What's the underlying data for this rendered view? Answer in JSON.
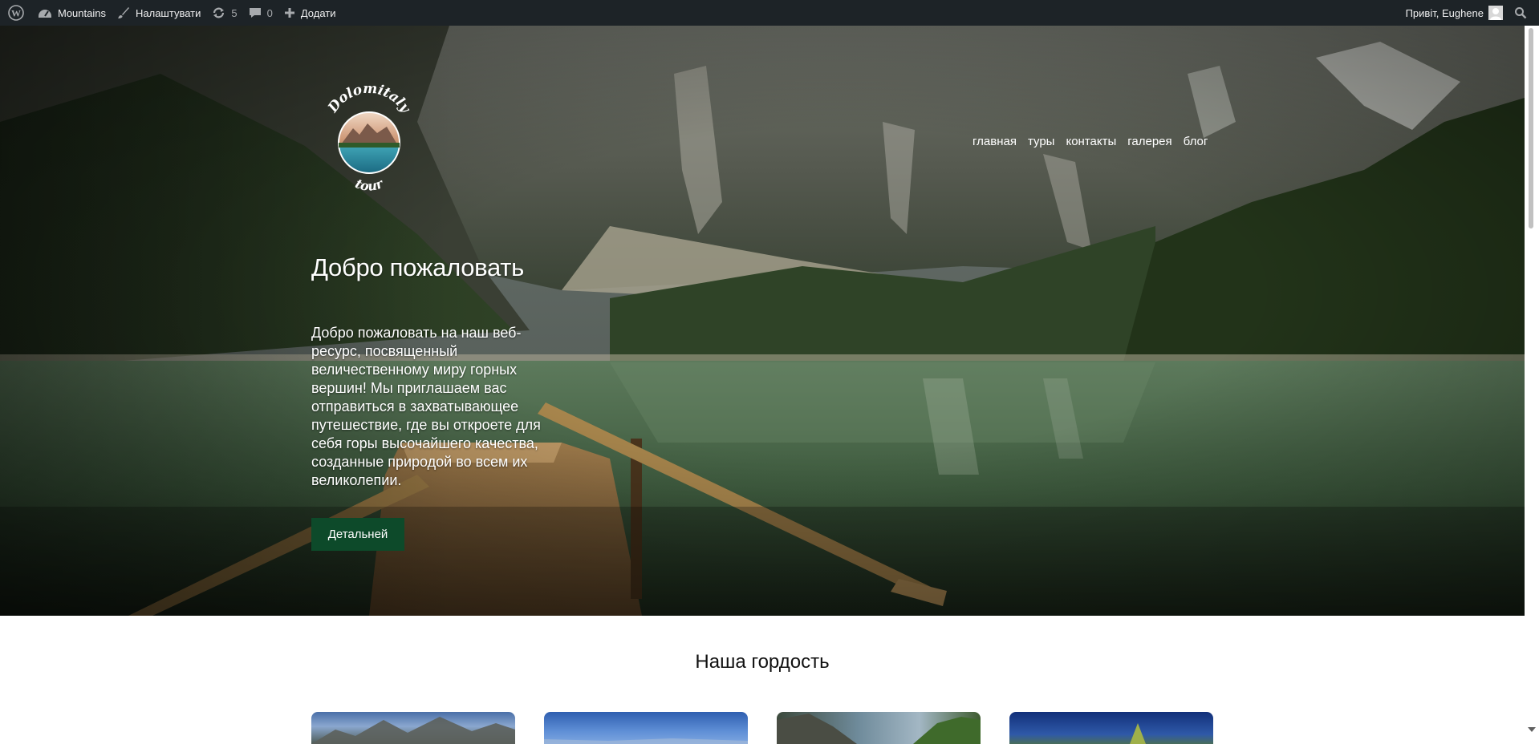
{
  "admin_bar": {
    "site_name": "Mountains",
    "customize_label": "Налаштувати",
    "updates_count": "5",
    "comments_count": "0",
    "new_label": "Додати",
    "greeting": "Привіт, Eughene",
    "icons": {
      "wp": "wordpress-icon",
      "site": "dashboard-icon",
      "customize": "brush-icon",
      "updates": "refresh-icon",
      "comments": "comment-icon",
      "new": "plus-icon",
      "search": "search-icon"
    },
    "bg_color": "#1d2327"
  },
  "logo": {
    "top_text": "Dolomitaly",
    "bottom_text": "tour"
  },
  "nav": {
    "items": [
      "главная",
      "туры",
      "контакты",
      "галерея",
      "блог"
    ]
  },
  "hero": {
    "title": "Добро пожаловать",
    "text": "Добро пожаловать на наш веб-ресурс, посвященный величественному миру горных вершин! Мы приглашаем вас отправиться в захватывающее путешествие, где вы откроете для себя горы высочайшего качества, созданные природой во всем их великолепии.",
    "button_label": "Детальней",
    "button_color": "#0d4a2a"
  },
  "section": {
    "title": "Наша гордость",
    "card_count": 4
  }
}
